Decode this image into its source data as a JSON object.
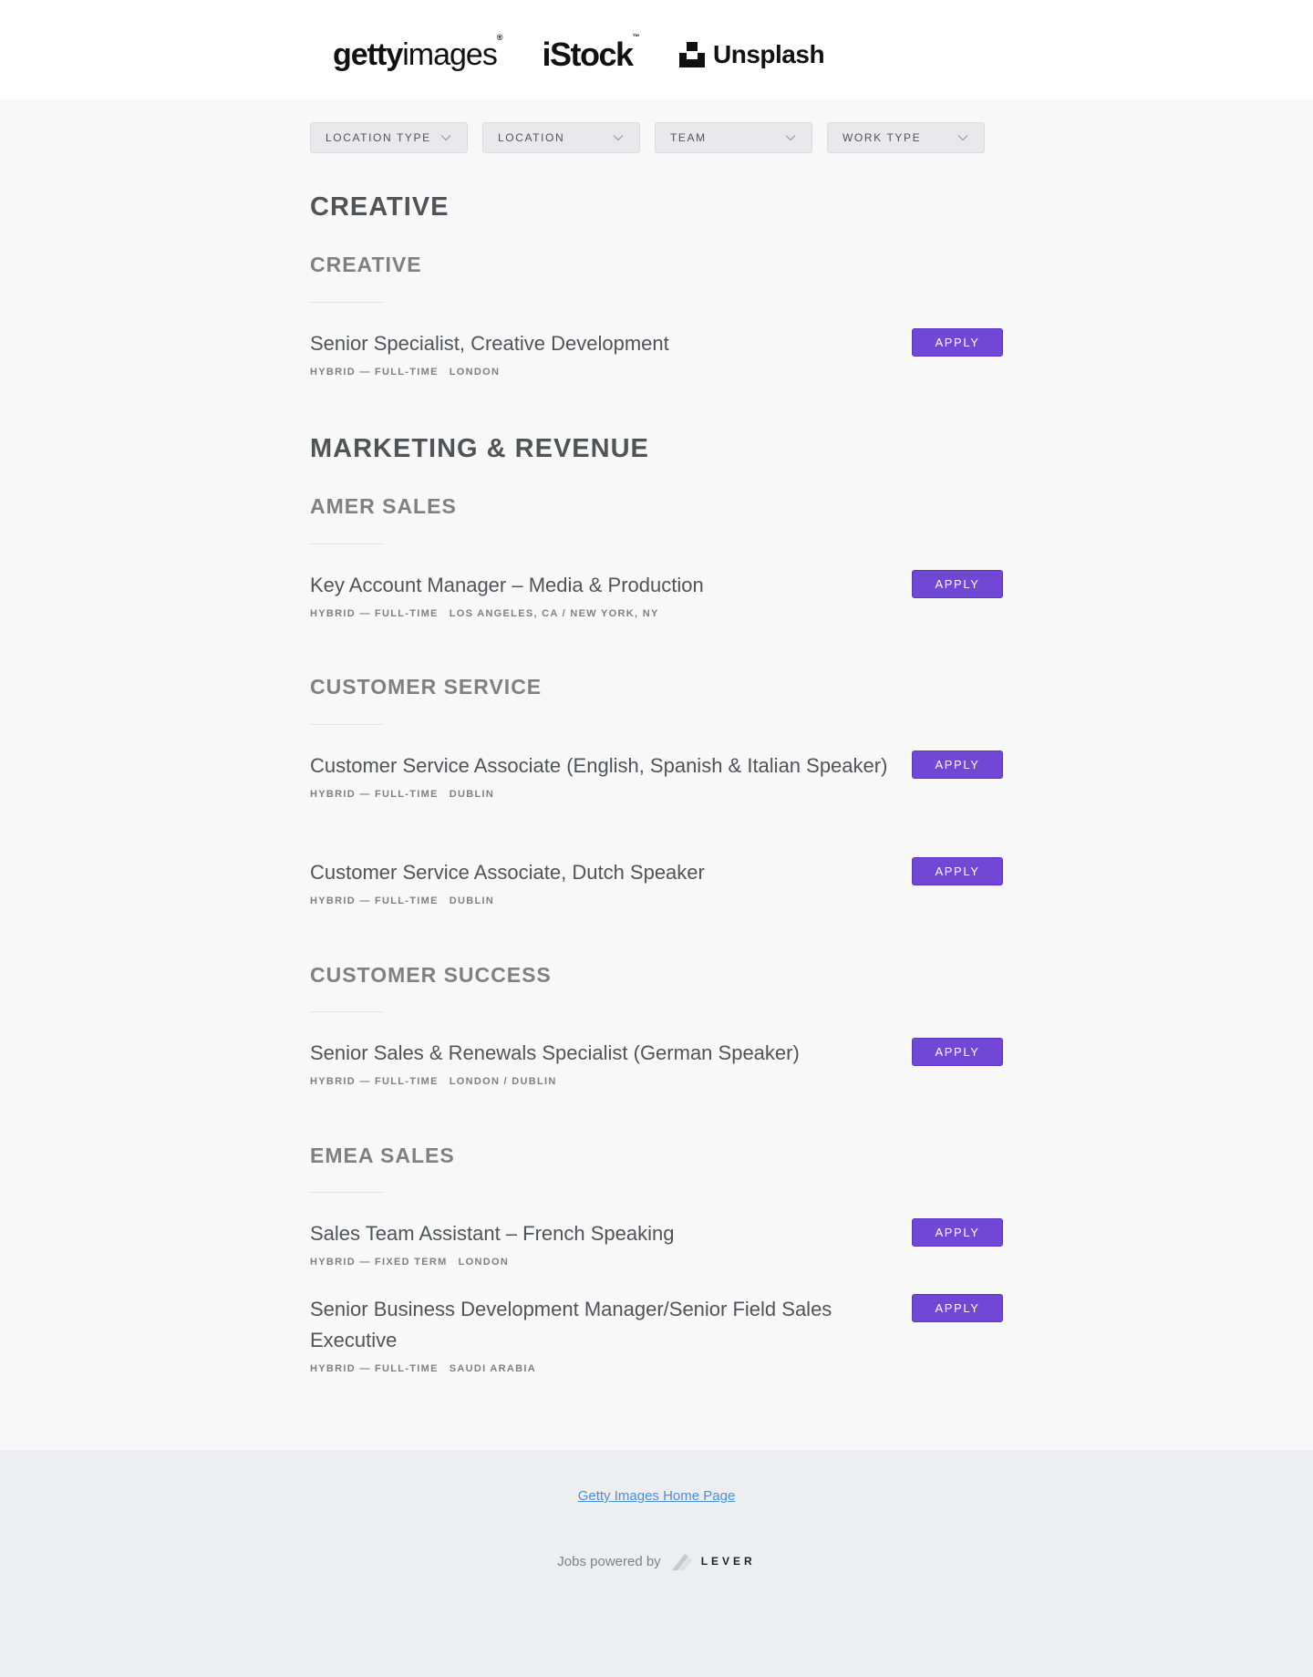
{
  "header": {
    "logos": {
      "getty_bold": "getty",
      "getty_light": "images",
      "getty_mark": "®",
      "istock": "iStock",
      "istock_mark": "™",
      "unsplash": "Unsplash"
    }
  },
  "filters": [
    {
      "label": "LOCATION TYPE",
      "icon": "chevron-down-icon"
    },
    {
      "label": "LOCATION",
      "icon": "chevron-down-icon"
    },
    {
      "label": "TEAM",
      "icon": "chevron-down-icon"
    },
    {
      "label": "WORK TYPE",
      "icon": "chevron-down-icon"
    }
  ],
  "apply_label": "APPLY",
  "departments": [
    {
      "title": "CREATIVE",
      "teams": [
        {
          "title": "CREATIVE",
          "postings": [
            {
              "title": "Senior Specialist, Creative Development",
              "commitment": "HYBRID — FULL-TIME",
              "location": "LONDON"
            }
          ]
        }
      ]
    },
    {
      "title": "MARKETING & REVENUE",
      "teams": [
        {
          "title": "AMER SALES",
          "postings": [
            {
              "title": "Key Account Manager – Media & Production",
              "commitment": "HYBRID — FULL-TIME",
              "location": "LOS ANGELES, CA / NEW YORK, NY"
            }
          ]
        },
        {
          "title": "CUSTOMER SERVICE",
          "postings": [
            {
              "title": "Customer Service Associate (English, Spanish & Italian Speaker)",
              "commitment": "HYBRID — FULL-TIME",
              "location": "DUBLIN"
            },
            {
              "title": "Customer Service Associate, Dutch Speaker",
              "commitment": "HYBRID — FULL-TIME",
              "location": "DUBLIN"
            }
          ]
        },
        {
          "title": "CUSTOMER SUCCESS",
          "postings": [
            {
              "title": "Senior Sales & Renewals Specialist (German Speaker)",
              "commitment": "HYBRID — FULL-TIME",
              "location": "LONDON / DUBLIN"
            }
          ]
        },
        {
          "title": "EMEA SALES",
          "postings": [
            {
              "title": "Sales Team Assistant – French Speaking",
              "commitment": "HYBRID — FIXED TERM",
              "location": "LONDON"
            },
            {
              "title": "Senior Business Development Manager/Senior Field Sales Executive",
              "commitment": "HYBRID — FULL-TIME",
              "location": "SAUDI ARABIA"
            }
          ]
        }
      ]
    }
  ],
  "footer": {
    "home_link": "Getty Images Home Page",
    "powered_by": "Jobs powered by",
    "lever": "LEVER"
  },
  "colors": {
    "accent": "#7147d6",
    "link": "#4a90d9",
    "page_bg": "#f8f8f9",
    "footer_bg": "#edeef1"
  }
}
